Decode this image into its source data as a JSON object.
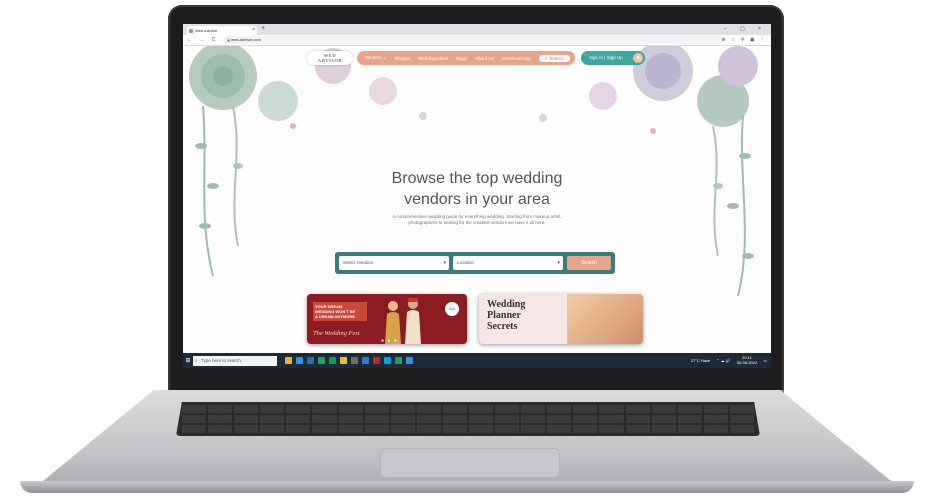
{
  "browser": {
    "tab_title": "Wed Advisor",
    "tab_close": "×",
    "new_tab": "+",
    "url": "wed-advisor.com",
    "nav_icons": "← → C ⌂",
    "window_controls": "– ▢ ×",
    "extensions": "⊕ ☆ ⚲ ▣ ⋮"
  },
  "site": {
    "logo_line1": "WED",
    "logo_line2": "ADVISOR",
    "menu": [
      "Vendors ⌄",
      "Shoppe",
      "Wedding Ideas",
      "Blogs",
      "About Us",
      "Download App"
    ],
    "search_label": "Search",
    "signin_label": "Sign In | Sign Up",
    "hero_title_line1": "Browse the top wedding",
    "hero_title_line2": "vendors in your area",
    "hero_sub_line1": "A comprehensive wedding guide for everything wedding. Starting from makeup artist,",
    "hero_sub_line2": "photographers to looking for the smallest vendors we have it all here.",
    "select_vendors": "Select Vendors",
    "select_location": "Location",
    "search_button": "Search",
    "banner1": {
      "tag_line1": "YOUR DREAM",
      "tag_line2": "WEDDING WON'T BE",
      "tag_line3": "A DREAM ANYMORE",
      "fest_prefix": "The",
      "fest_name": "Wedding Fest",
      "logo": "WA"
    },
    "banner2": {
      "title_line1": "Wedding",
      "title_line2": "Planner",
      "title_line3": "Secrets"
    }
  },
  "taskbar": {
    "search_placeholder": "Type here to search",
    "weather": "27°C Haze",
    "time": "20:11",
    "date": "30-08-2022"
  },
  "colors": {
    "menu_bg": "#e9a58b",
    "signin_bg": "#3fa6a0",
    "searchbox_bg": "#3d7a78",
    "banner1_bg": "#8b1d22"
  }
}
